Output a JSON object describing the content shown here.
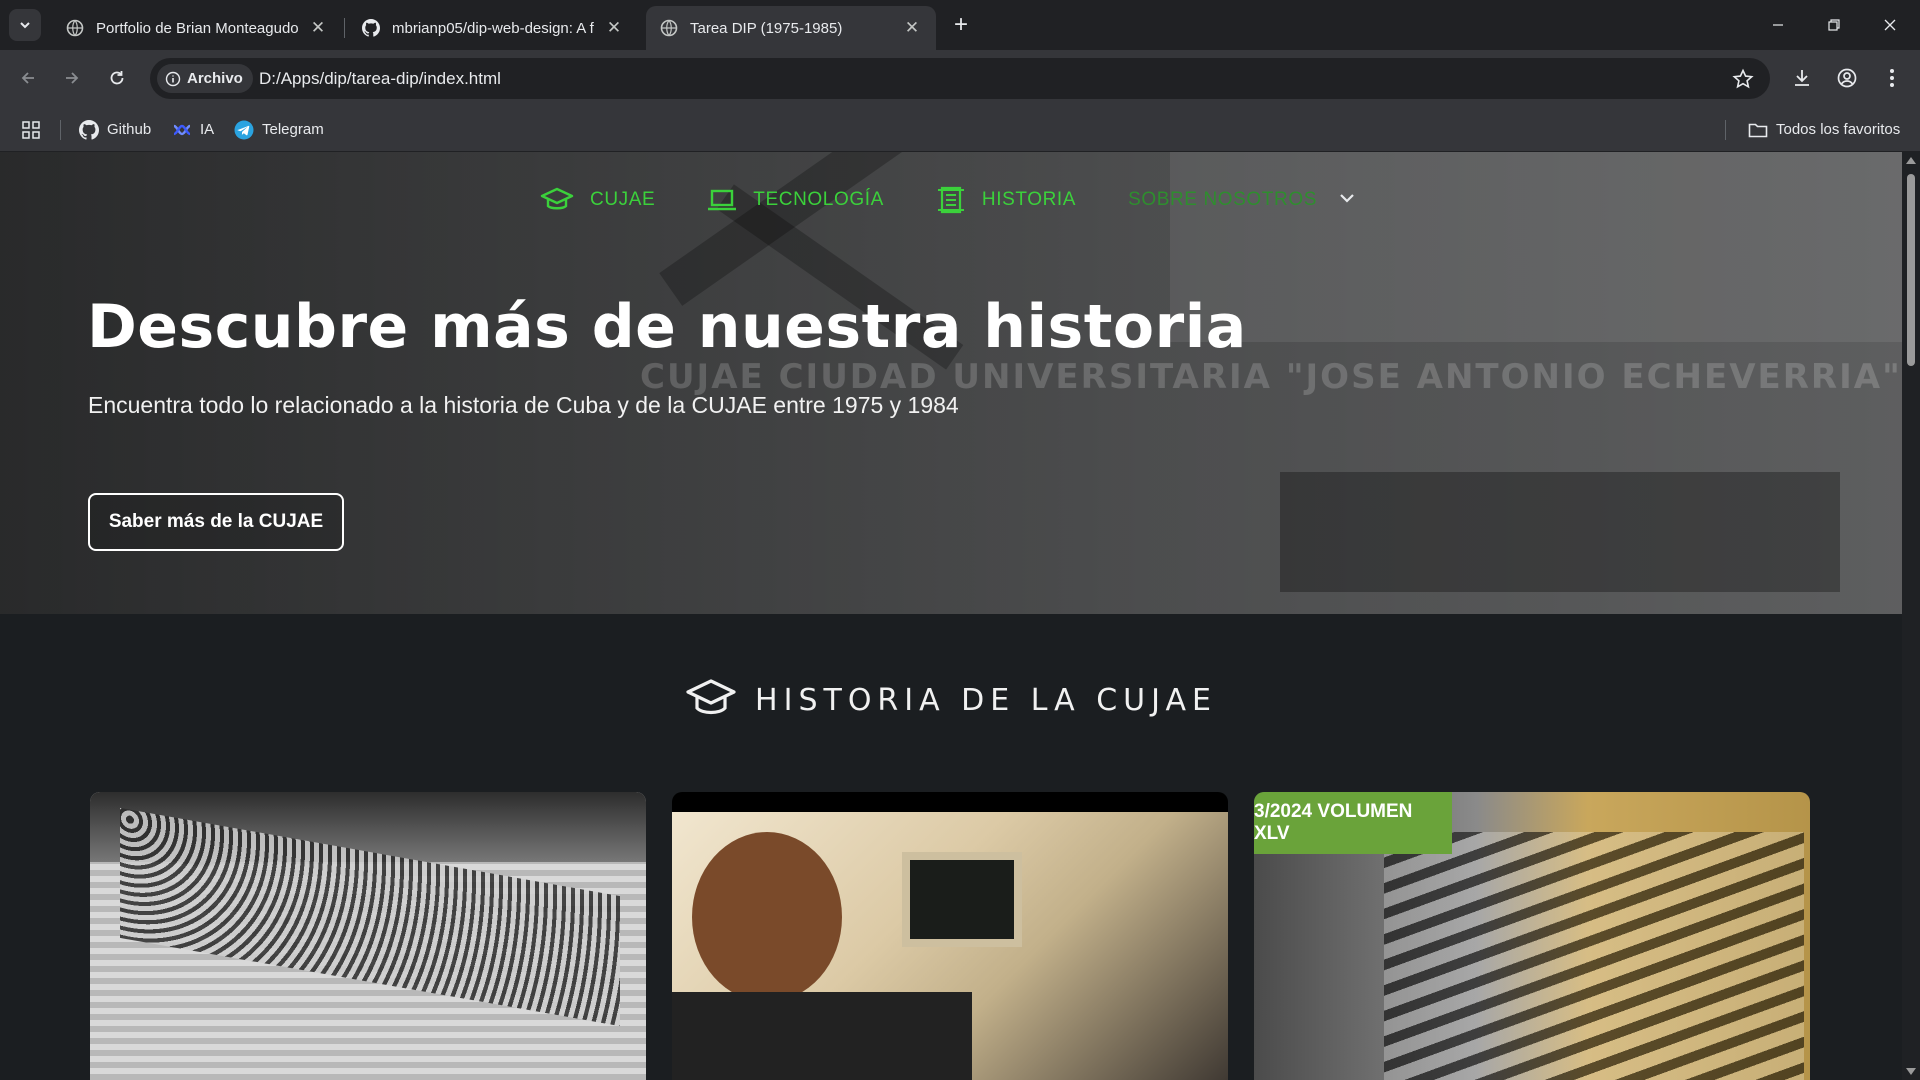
{
  "browser": {
    "tabs": [
      {
        "title": "Portfolio de Brian Monteagudo",
        "active": false
      },
      {
        "title": "mbrianp05/dip-web-design: A f",
        "active": false
      },
      {
        "title": "Tarea DIP (1975-1985)",
        "active": true
      }
    ],
    "address": {
      "chip_label": "Archivo",
      "url": "D:/Apps/dip/tarea-dip/index.html"
    },
    "bookmarks": [
      {
        "label": "Github",
        "icon": "github-icon"
      },
      {
        "label": "IA",
        "icon": "ai-icon"
      },
      {
        "label": "Telegram",
        "icon": "telegram-icon"
      }
    ],
    "all_bookmarks_label": "Todos los favoritos"
  },
  "site": {
    "nav": [
      {
        "label": "CUJAE",
        "icon": "graduation-cap-icon"
      },
      {
        "label": "TECNOLOGÍA",
        "icon": "laptop-icon"
      },
      {
        "label": "HISTORIA",
        "icon": "scroll-icon"
      },
      {
        "label": "SOBRE NOSOTROS",
        "icon": "chevron-down-icon"
      }
    ],
    "hero": {
      "banner_text": "CUJAE CIUDAD UNIVERSITARIA \"JOSE ANTONIO ECHEVERRIA\"",
      "title": "Descubre más de nuestra historia",
      "lead": "Encuentra todo lo relacionado a la historia de Cuba y de la CUJAE entre 1975 y 1984",
      "cta": "Saber más de la CUJAE"
    },
    "section": {
      "title": "HISTORIA DE LA CUJAE"
    },
    "cards": [
      {
        "image": "group-photo"
      },
      {
        "image": "computer-photo"
      },
      {
        "image": "magazine-cover",
        "tag": "3/2024 VOLUMEN XLV"
      }
    ]
  },
  "colors": {
    "accent_green": "#3bd13b",
    "chrome_dark": "#202124",
    "chrome_mid": "#35363a",
    "page_bg": "#1b1e21"
  }
}
